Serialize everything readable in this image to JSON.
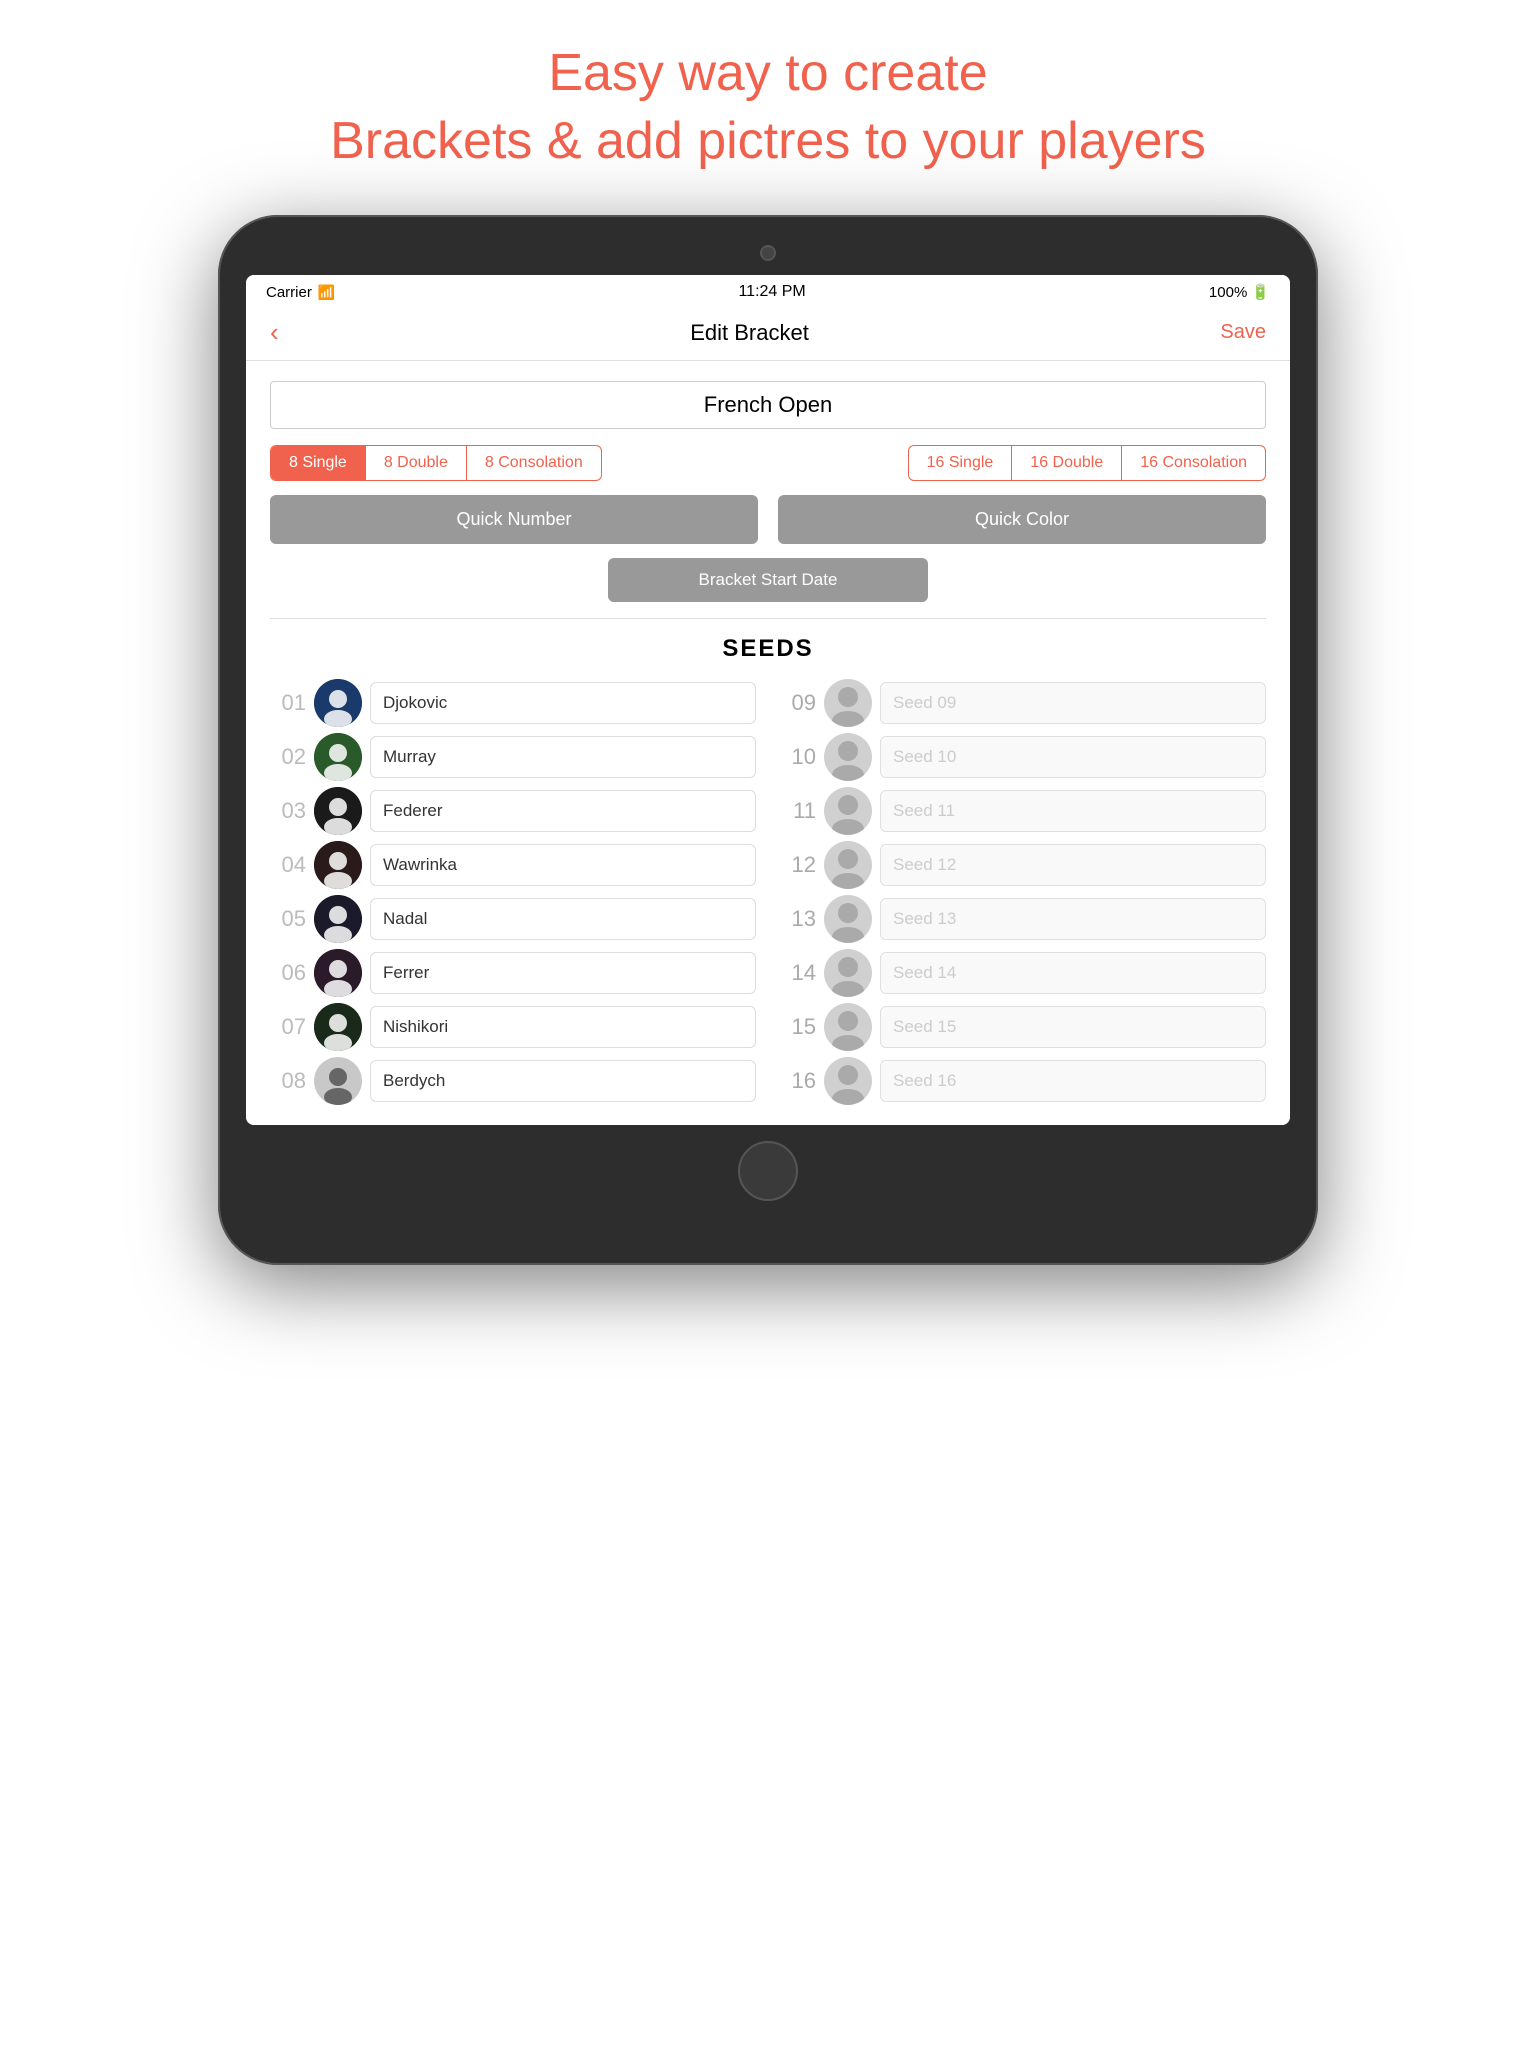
{
  "promo": {
    "line1": "Easy way to create",
    "line2": "Brackets & add pictres to your players"
  },
  "statusBar": {
    "carrier": "Carrier",
    "time": "11:24 PM",
    "battery": "100%"
  },
  "navBar": {
    "back": "‹",
    "title": "Edit Bracket",
    "save": "Save"
  },
  "tournamentName": "French Open",
  "bracketGroups": {
    "group1": {
      "buttons": [
        {
          "label": "8 Single",
          "active": true
        },
        {
          "label": "8 Double",
          "active": false
        },
        {
          "label": "8 Consolation",
          "active": false
        }
      ]
    },
    "group2": {
      "buttons": [
        {
          "label": "16 Single",
          "active": false
        },
        {
          "label": "16 Double",
          "active": false
        },
        {
          "label": "16 Consolation",
          "active": false
        }
      ]
    }
  },
  "quickActions": {
    "quickNumber": "Quick Number",
    "quickColor": "Quick Color",
    "bracketStartDate": "Bracket Start Date"
  },
  "seedsTitle": "SEEDS",
  "seeds": [
    {
      "number": "01",
      "name": "Djokovic",
      "hasPhoto": true,
      "avatarClass": "avatar-djokovic",
      "placeholder": false
    },
    {
      "number": "02",
      "name": "Murray",
      "hasPhoto": true,
      "avatarClass": "avatar-murray",
      "placeholder": false
    },
    {
      "number": "03",
      "name": "Federer",
      "hasPhoto": true,
      "avatarClass": "avatar-federer",
      "placeholder": false
    },
    {
      "number": "04",
      "name": "Wawrinka",
      "hasPhoto": true,
      "avatarClass": "avatar-wawrinka",
      "placeholder": false
    },
    {
      "number": "05",
      "name": "Nadal",
      "hasPhoto": true,
      "avatarClass": "avatar-nadal",
      "placeholder": false
    },
    {
      "number": "06",
      "name": "Ferrer",
      "hasPhoto": true,
      "avatarClass": "avatar-ferrer",
      "placeholder": false
    },
    {
      "number": "07",
      "name": "Nishikori",
      "hasPhoto": true,
      "avatarClass": "avatar-nishikori",
      "placeholder": false
    },
    {
      "number": "08",
      "name": "Berdych",
      "hasPhoto": true,
      "avatarClass": "avatar-berdych",
      "placeholder": false
    },
    {
      "number": "09",
      "name": "Seed 09",
      "hasPhoto": false,
      "avatarClass": "",
      "placeholder": true
    },
    {
      "number": "10",
      "name": "Seed 10",
      "hasPhoto": false,
      "avatarClass": "",
      "placeholder": true
    },
    {
      "number": "11",
      "name": "Seed 11",
      "hasPhoto": false,
      "avatarClass": "",
      "placeholder": true
    },
    {
      "number": "12",
      "name": "Seed 12",
      "hasPhoto": false,
      "avatarClass": "",
      "placeholder": true
    },
    {
      "number": "13",
      "name": "Seed 13",
      "hasPhoto": false,
      "avatarClass": "",
      "placeholder": true
    },
    {
      "number": "14",
      "name": "Seed 14",
      "hasPhoto": false,
      "avatarClass": "",
      "placeholder": true
    },
    {
      "number": "15",
      "name": "Seed 15",
      "hasPhoto": false,
      "avatarClass": "",
      "placeholder": true
    },
    {
      "number": "16",
      "name": "Seed 16",
      "hasPhoto": false,
      "avatarClass": "",
      "placeholder": true
    }
  ]
}
